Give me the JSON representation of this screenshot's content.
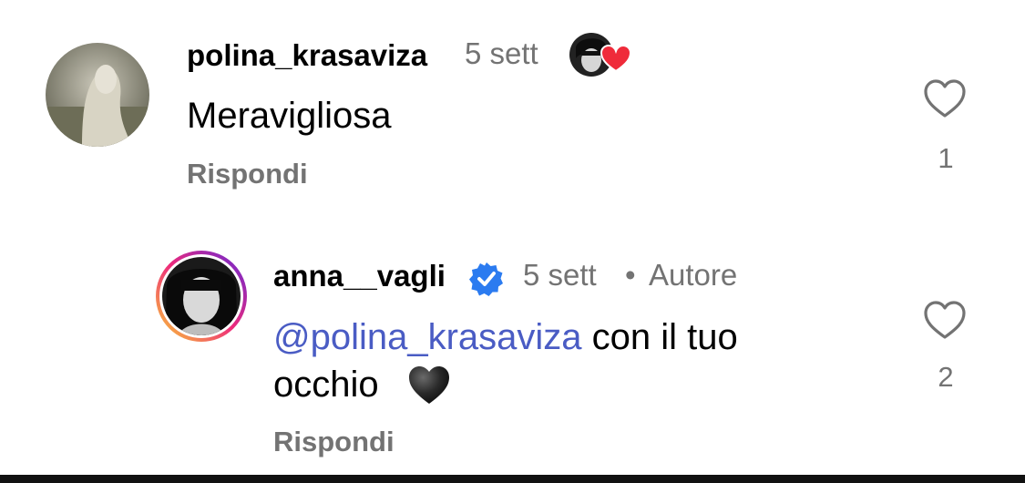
{
  "comments": [
    {
      "username": "polina_krasaviza",
      "time": "5 sett",
      "text": "Meravigliosa",
      "reply_label": "Rispondi",
      "like_count": "1",
      "liked_by_author_badge": "heart-badge-icon"
    },
    {
      "username": "anna__vagli",
      "verified_icon": "verified-badge-icon",
      "time": "5 sett",
      "separator": "•",
      "role": "Autore",
      "mention": "@polina_krasaviza",
      "text_line1": " con il tuo",
      "text_line2": "occhio",
      "emoji": "black-heart-icon",
      "reply_label": "Rispondi",
      "like_count": "2"
    }
  ],
  "colors": {
    "muted": "#737373",
    "mention": "#4a5cc4",
    "verified": "#2b7bf0",
    "heart_badge": "#ef2b3a",
    "story_ring_start": "#f9ce34",
    "story_ring_mid": "#ee2a7b",
    "story_ring_end": "#6228d7"
  }
}
